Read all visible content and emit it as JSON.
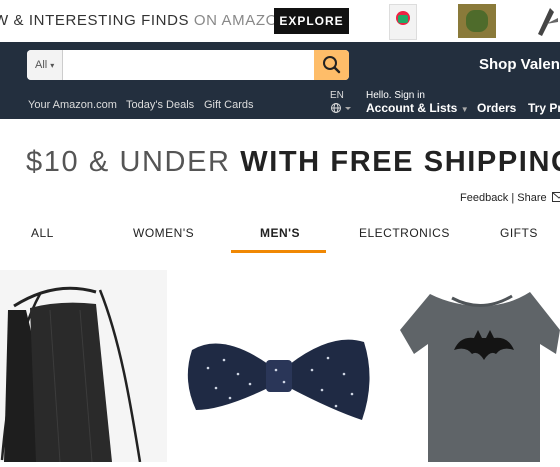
{
  "banner": {
    "text_bold": "W & INTERESTING FINDS",
    "text_light": "ON AMAZON",
    "explore_label": "EXPLORE"
  },
  "search": {
    "category": "All",
    "query": ""
  },
  "header": {
    "shop_text": "Shop Valent",
    "nav_links": [
      "Your Amazon.com",
      "Today's Deals",
      "Gift Cards"
    ],
    "language": "EN",
    "greeting": "Hello. Sign in",
    "account_label": "Account & Lists",
    "orders_label": "Orders",
    "try_label": "Try Pr"
  },
  "page": {
    "headline_light": "$10 & UNDER",
    "headline_strong": "WITH FREE SHIPPING",
    "feedback": "Feedback",
    "share": "Share"
  },
  "tabs": [
    "ALL",
    "WOMEN'S",
    "MEN'S",
    "ELECTRONICS",
    "GIFTS"
  ],
  "active_tab": "MEN'S",
  "colors": {
    "nav_bg": "#232f3e",
    "search_button": "#febd69",
    "tab_underline": "#f08804"
  }
}
